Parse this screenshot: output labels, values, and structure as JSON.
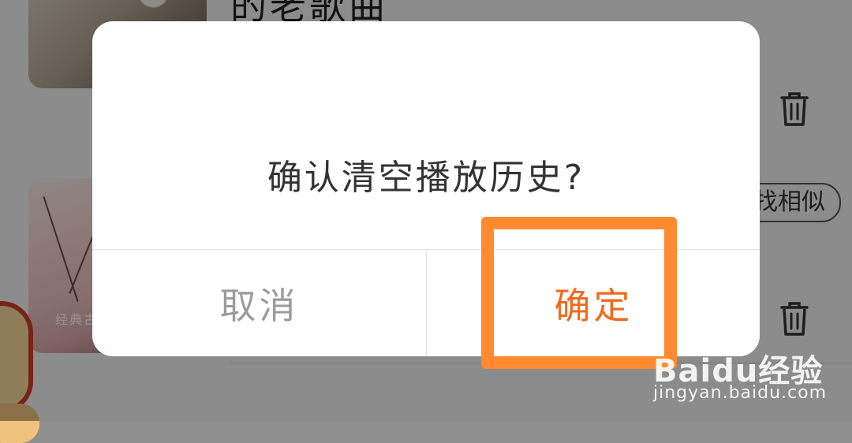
{
  "background": {
    "song_title_partial": "的老歌曲",
    "thumbnail_caption": "经典古",
    "similar_button_label": "找相似",
    "delete_icons": [
      "trash-icon",
      "trash-icon"
    ]
  },
  "dialog": {
    "message": "确认清空播放历史?",
    "cancel_label": "取消",
    "confirm_label": "确定"
  },
  "watermark": {
    "brand": "Baidu经验",
    "url": "jingyan.baidu.com"
  },
  "colors": {
    "confirm_text": "#ef6a1d",
    "cancel_text": "#9b9b9b",
    "highlight_border": "#ff8a2f",
    "overlay": "rgba(0,0,0,0.42)"
  }
}
